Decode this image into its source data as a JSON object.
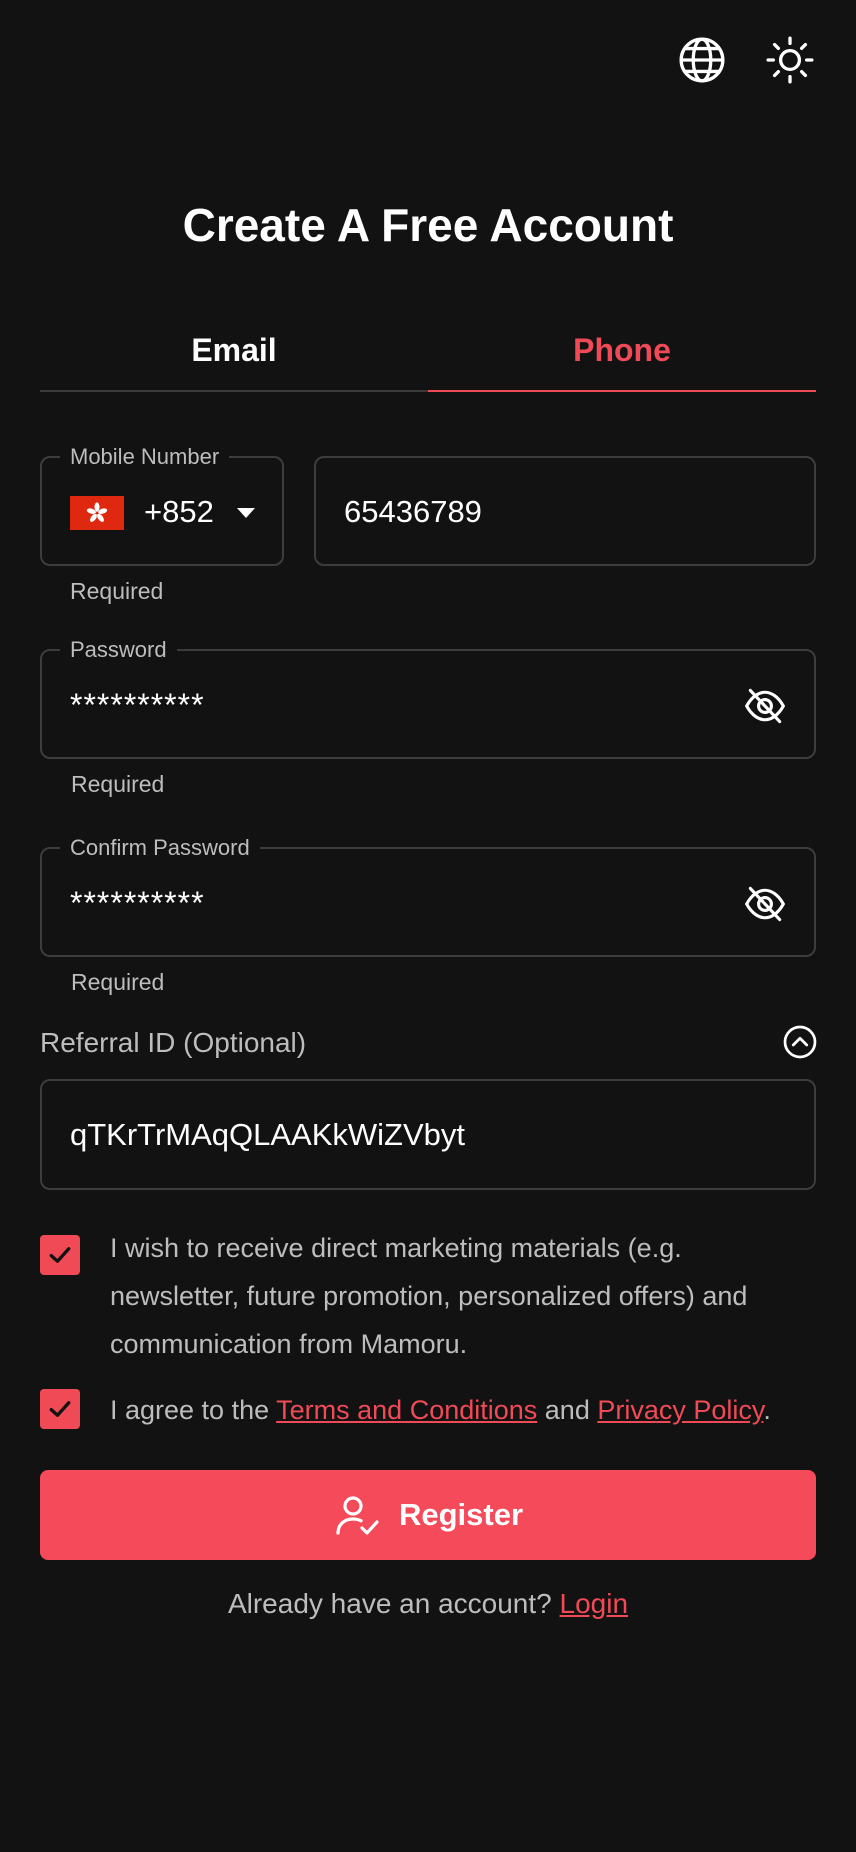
{
  "header": {
    "language_icon": "globe-icon",
    "theme_icon": "sun-icon",
    "title": "Create A Free Account"
  },
  "tabs": [
    {
      "label": "Email",
      "active": false
    },
    {
      "label": "Phone",
      "active": true
    }
  ],
  "mobile": {
    "legend": "Mobile Number",
    "country_flag": "hong-kong-flag-icon",
    "dial_code": "+852",
    "number": "65436789",
    "helper": "Required"
  },
  "password": {
    "legend": "Password",
    "value": "**********",
    "helper": "Required"
  },
  "confirm_password": {
    "legend": "Confirm Password",
    "value": "**********",
    "helper": "Required"
  },
  "referral": {
    "label": "Referral ID (Optional)",
    "value": "qTKrTrMAqQLAAKkWiZVbyt"
  },
  "consents": {
    "marketing_text": "I wish to receive direct marketing materials (e.g. newsletter, future promotion, personalized offers) and communication from Mamoru.",
    "marketing_checked": true,
    "terms_prefix": "I agree to the ",
    "terms_link": "Terms and Conditions",
    "terms_and": " and ",
    "privacy_link": "Privacy Policy",
    "terms_suffix": ".",
    "terms_checked": true
  },
  "register": {
    "label": "Register"
  },
  "footer": {
    "prompt": "Already have an account? ",
    "login_link": "Login"
  },
  "colors": {
    "background": "#121212",
    "accent": "#f04a57",
    "button": "#f54a5a",
    "muted_text": "#bdbdbd",
    "border": "#3d3d3d"
  }
}
